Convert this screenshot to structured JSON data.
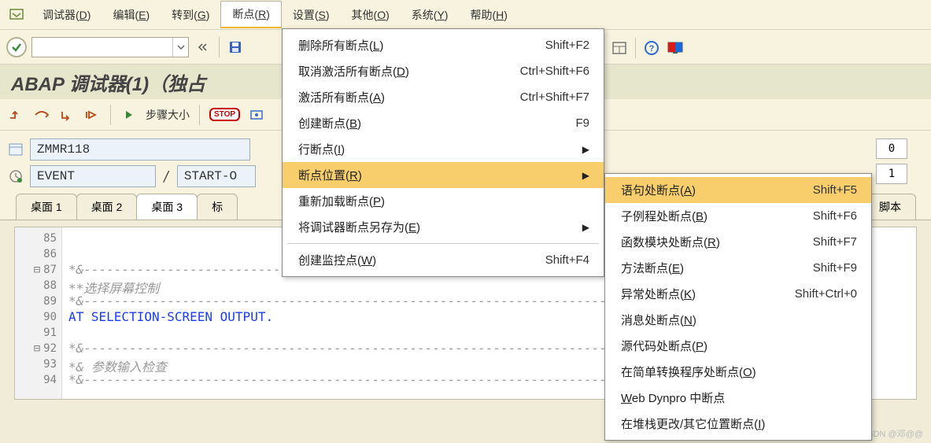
{
  "menubar": {
    "items": [
      "调试器(",
      "编辑(",
      "转到(",
      "断点(",
      "设置(",
      "其他(",
      "系统(",
      "帮助("
    ],
    "keys": [
      "D",
      "E",
      "G",
      "R",
      "S",
      "O",
      "Y",
      "H"
    ],
    "close": ")"
  },
  "title": "ABAP 调试器(1)（独占",
  "step_label": "步骤大小",
  "stop_label": "STOP",
  "fields": {
    "program": "ZMMR118",
    "event": "EVENT",
    "start": "START-O",
    "val0": "0",
    "val1": "1"
  },
  "tabs": [
    "桌面 1",
    "桌面 2",
    "桌面 3",
    "标",
    "脚本"
  ],
  "code": {
    "lines": [
      85,
      86,
      87,
      88,
      89,
      90,
      91,
      92,
      93,
      94
    ],
    "l87": "*&---------------------------------------------------------------------",
    "l88": "**选择屏幕控制",
    "l89": "*&---------------------------------------------------------------------",
    "l90": "AT SELECTION-SCREEN OUTPUT.",
    "l92": "*&---------------------------------------------------------------------",
    "l93": "*& 参数输入检查",
    "l94": "*&---------------------------------------------------------------------"
  },
  "dd1": [
    {
      "label": "删除所有断点(",
      "key": "L",
      "shortcut": "Shift+F2"
    },
    {
      "label": "取消激活所有断点(",
      "key": "D",
      "shortcut": "Ctrl+Shift+F6"
    },
    {
      "label": "激活所有断点(",
      "key": "A",
      "shortcut": "Ctrl+Shift+F7"
    },
    {
      "label": "创建断点(",
      "key": "B",
      "shortcut": "F9"
    },
    {
      "label": "行断点(",
      "key": "I",
      "submenu": true
    },
    {
      "label": "断点位置(",
      "key": "R",
      "submenu": true,
      "highlight": true
    },
    {
      "label": "重新加载断点(",
      "key": "P"
    },
    {
      "label": "将调试器断点另存为(",
      "key": "E",
      "submenu": true
    },
    {
      "sep": true
    },
    {
      "label": "创建监控点(",
      "key": "W",
      "shortcut": "Shift+F4"
    }
  ],
  "dd2": [
    {
      "label": "语句处断点(",
      "key": "A",
      "shortcut": "Shift+F5",
      "highlight": true
    },
    {
      "label": "子例程处断点(",
      "key": "B",
      "shortcut": "Shift+F6"
    },
    {
      "label": "函数模块处断点(",
      "key": "R",
      "shortcut": "Shift+F7"
    },
    {
      "label": "方法断点(",
      "key": "E",
      "shortcut": "Shift+F9"
    },
    {
      "label": "异常处断点(",
      "key": "K",
      "shortcut": "Shift+Ctrl+0"
    },
    {
      "label": "消息处断点(",
      "key": "N"
    },
    {
      "label": "源代码处断点(",
      "key": "P"
    },
    {
      "label": "在简单转换程序处断点(",
      "key": "O"
    },
    {
      "label_raw": "Web Dynpro 中断点",
      "underline_first": true
    },
    {
      "label": "在堆栈更改/其它位置断点(",
      "key": "I"
    }
  ],
  "watermark": "CSDN @邓@@"
}
